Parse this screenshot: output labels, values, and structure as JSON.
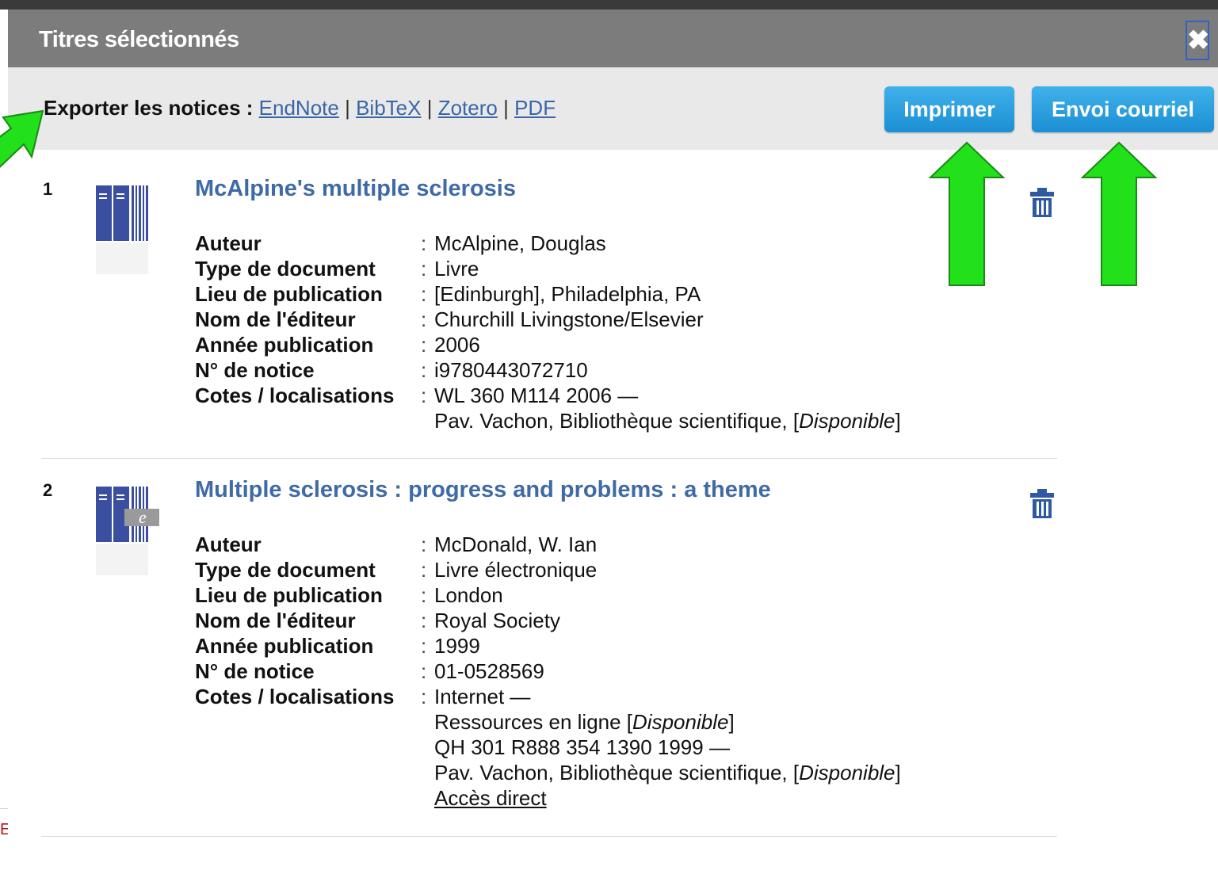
{
  "dialog": {
    "title": "Titres sélectionnés",
    "close_label": "✖"
  },
  "toolbar": {
    "export_label": "Exporter les notices :",
    "export_links": [
      "EndNote",
      "BibTeX",
      "Zotero",
      "PDF"
    ],
    "separator": "|",
    "print_label": "Imprimer",
    "email_label": "Envoi courriel"
  },
  "records": [
    {
      "number": "1",
      "title": "McAlpine's multiple sclerosis",
      "icon": "print-book-icon",
      "fields": {
        "author_label": "Auteur",
        "author": "McAlpine, Douglas",
        "doctype_label": "Type de document",
        "doctype": "Livre",
        "place_label": "Lieu de publication",
        "place": "[Edinburgh], Philadelphia, PA",
        "publisher_label": "Nom de l'éditeur",
        "publisher": "Churchill Livingstone/Elsevier",
        "year_label": "Année publication",
        "year": "2006",
        "id_label": "N° de notice",
        "id": "i9780443072710",
        "callno_label": "Cotes / localisations",
        "callno_1": "WL 360 M114 2006 —",
        "location_1": "Pav. Vachon, Bibliothèque scientifique, [",
        "status_1": "Disponible",
        "close_bracket": "]"
      }
    },
    {
      "number": "2",
      "title": "Multiple sclerosis : progress and problems : a theme",
      "icon": "ebook-icon",
      "fields": {
        "author_label": "Auteur",
        "author": "McDonald, W. Ian",
        "doctype_label": "Type de document",
        "doctype": "Livre électronique",
        "place_label": "Lieu de publication",
        "place": "London",
        "publisher_label": "Nom de l'éditeur",
        "publisher": "Royal Society",
        "year_label": "Année publication",
        "year": "1999",
        "id_label": "N° de notice",
        "id": "01-0528569",
        "callno_label": "Cotes / localisations",
        "callno_1": "Internet —",
        "location_1": "Ressources en ligne [",
        "status_1": "Disponible",
        "callno_2": "QH 301 R888 354 1390 1999 —",
        "location_2": "Pav. Vachon, Bibliothèque scientifique, [",
        "status_2": "Disponible",
        "close_bracket": "]",
        "direct_access": "Accès direct"
      }
    }
  ],
  "colors": {
    "titlebar": "#7c7c7c",
    "toolbar": "#e9e9e9",
    "button": "#1c8fd4",
    "link": "#3a66a8",
    "record_title": "#3f6aa6",
    "annotation_arrow": "#22e01a"
  },
  "page_edge_text": "E"
}
